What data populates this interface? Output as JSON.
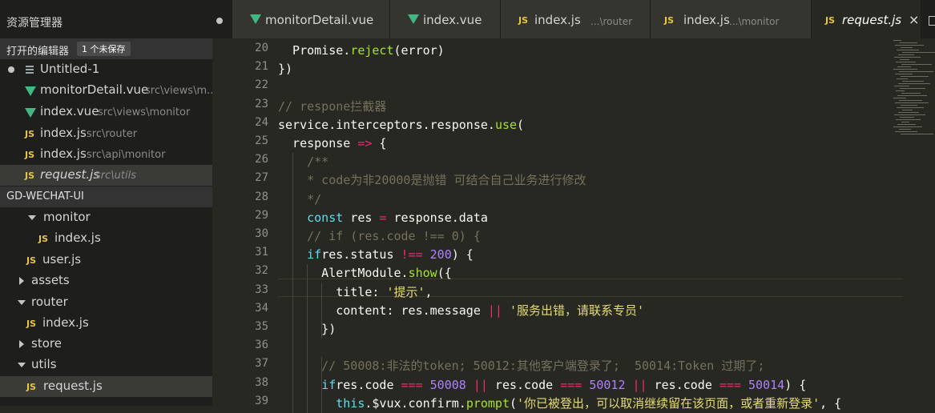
{
  "sidebar": {
    "title": "资源管理器",
    "open_editors": {
      "header": "打开的编辑器",
      "badge": "1 个未保存",
      "items": [
        {
          "name": "Untitled-1",
          "path": "",
          "type": "text",
          "modified": true
        },
        {
          "name": "monitorDetail.vue",
          "path": "src\\views\\m...",
          "type": "vue"
        },
        {
          "name": "index.vue",
          "path": "src\\views\\monitor",
          "type": "vue"
        },
        {
          "name": "index.js",
          "path": "src\\router",
          "type": "js"
        },
        {
          "name": "index.js",
          "path": "src\\api\\monitor",
          "type": "js"
        },
        {
          "name": "request.js",
          "path": "src\\utils",
          "type": "js",
          "active": true
        }
      ]
    },
    "project": {
      "header": "GD-WECHAT-UI",
      "tree": [
        {
          "label": "monitor",
          "kind": "folder-open"
        },
        {
          "label": "index.js",
          "kind": "js"
        },
        {
          "label": "user.js",
          "kind": "js"
        },
        {
          "label": "assets",
          "kind": "folder-closed"
        },
        {
          "label": "router",
          "kind": "folder-open"
        },
        {
          "label": "index.js",
          "kind": "js"
        },
        {
          "label": "store",
          "kind": "folder-closed"
        },
        {
          "label": "utils",
          "kind": "folder-open"
        },
        {
          "label": "request.js",
          "kind": "js",
          "active": true
        }
      ]
    }
  },
  "tabs": [
    {
      "label": "monitorDetail.vue",
      "type": "vue",
      "path": ""
    },
    {
      "label": "index.vue",
      "type": "vue",
      "path": ""
    },
    {
      "label": "index.js",
      "type": "js",
      "path": "...\\router"
    },
    {
      "label": "index.js",
      "type": "js",
      "path": "...\\monitor"
    },
    {
      "label": "request.js",
      "type": "js",
      "path": "",
      "active": true,
      "close": "×"
    }
  ],
  "icons": {
    "js": "JS",
    "vue": "vue-icon"
  },
  "editor": {
    "line_numbers": [
      "20",
      "21",
      "22",
      "23",
      "24",
      "25",
      "26",
      "27",
      "28",
      "29",
      "30",
      "31",
      "32",
      "33",
      "34",
      "35",
      "36",
      "37",
      "38",
      "39"
    ],
    "lines": [
      "  Promise.reject(error)",
      "})",
      "",
      "// respone拦截器",
      "service.interceptors.response.use(",
      "  response => {",
      "    /**",
      "    * code为非20000是抛错 可结合自己业务进行修改",
      "    */",
      "    const res = response.data",
      "    // if (res.code !== 0) {",
      "    if (res.status !== 200) {",
      "      AlertModule.show({",
      "        title: '提示',",
      "        content: res.message || '服务出错，请联系专员'",
      "      })",
      "",
      "      // 50008:非法的token; 50012:其他客户端登录了;  50014:Token 过期了;",
      "      if (res.code === 50008 || res.code === 50012 || res.code === 50014) {",
      "        this.$vux.confirm.prompt('你已被登出，可以取消继续留在该页面，或者重新登录', {"
    ]
  }
}
